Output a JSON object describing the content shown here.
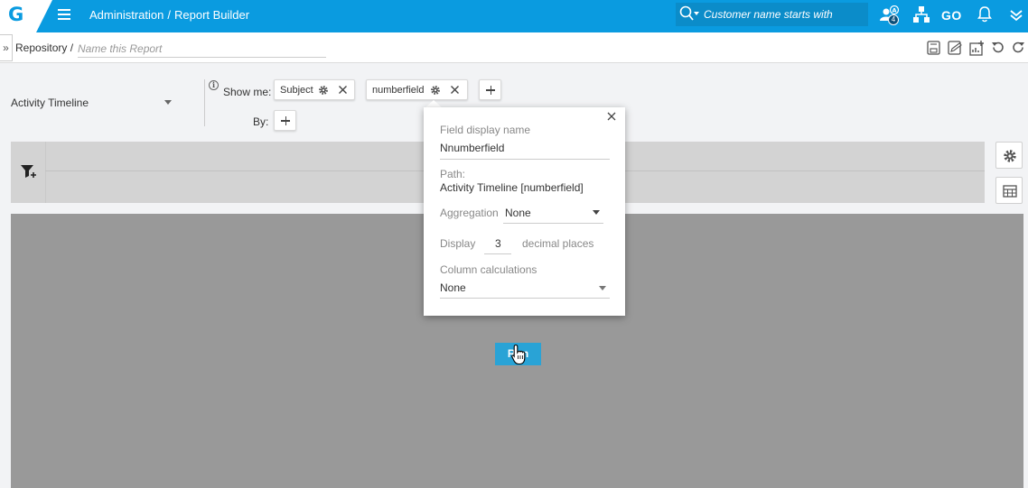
{
  "topbar": {
    "logo_letter": "G",
    "breadcrumb": [
      "Administration",
      "Report Builder"
    ],
    "breadcrumb_sep": "/",
    "search_placeholder": "Customer name starts with",
    "team_badge_count": "4",
    "go_label": "GO"
  },
  "subbar": {
    "expand_glyph": "»",
    "repository_label": "Repository /",
    "report_name_placeholder": "Name this Report"
  },
  "config": {
    "data_source": "Activity Timeline",
    "show_me_label": "Show me:",
    "by_label": "By:",
    "fields": [
      {
        "label": "Subject"
      },
      {
        "label": "numberfield"
      }
    ]
  },
  "popover": {
    "display_name_label": "Field display name",
    "display_name_value": "Nnumberfield",
    "path_label": "Path:",
    "path_value": "Activity Timeline [numberfield]",
    "aggregation_label": "Aggregation",
    "aggregation_value": "None",
    "display_label": "Display",
    "decimal_value": "3",
    "decimal_suffix": "decimal places",
    "column_calc_label": "Column calculations",
    "column_calc_value": "None"
  },
  "results": {
    "run_label": "Run"
  },
  "colors": {
    "topbar": "#0a9be0",
    "run_button": "#29a3d6",
    "overlay": "#999999"
  }
}
